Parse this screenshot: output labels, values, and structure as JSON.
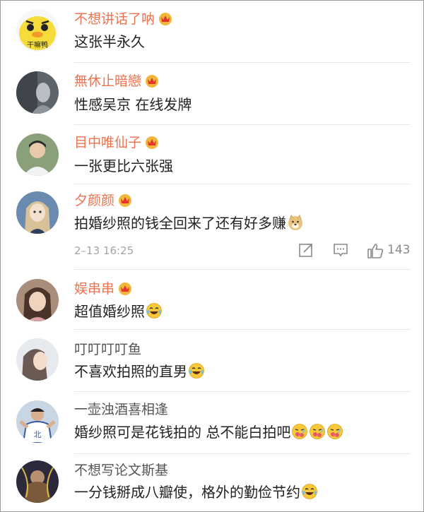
{
  "comments": [
    {
      "user": "不想讲话了呐",
      "vip": true,
      "avatar": "yellow-duck-avatar",
      "avatar_text": "干嘛鸭",
      "text": "这张半永久",
      "emoji": []
    },
    {
      "user": "無休止暗戀",
      "vip": true,
      "avatar": "gray-photo-avatar",
      "text": "性感吴京 在线发牌",
      "emoji": []
    },
    {
      "user": "目中唯仙子",
      "vip": true,
      "avatar": "man-portrait-avatar",
      "text": "一张更比六张强",
      "emoji": []
    },
    {
      "user": "夕颜颜",
      "vip": true,
      "avatar": "anime-girl-avatar",
      "text": "拍婚纱照的钱全回来了还有好多赚",
      "emoji": [
        "doge-emoji"
      ]
    },
    {
      "user": "娱串串",
      "vip": true,
      "avatar": "woman-portrait-avatar",
      "text": "超值婚纱照",
      "emoji": [
        "laugh-cry-emoji"
      ]
    },
    {
      "user": "叮叮叮叮鱼",
      "vip": false,
      "avatar": "pale-portrait-avatar",
      "text": "不喜欢拍照的直男",
      "emoji": [
        "laugh-cry-emoji"
      ]
    },
    {
      "user": "一壶浊酒喜相逢",
      "vip": false,
      "avatar": "athlete-avatar",
      "text": "婚纱照可是花钱拍的 总不能白拍吧",
      "emoji": [
        "drooling-emoji",
        "drooling-emoji",
        "drooling-emoji"
      ]
    },
    {
      "user": "不想写论文斯基",
      "vip": false,
      "avatar": "dark-fantasy-avatar",
      "text": "一分钱掰成八瓣使，格外的勤俭节约",
      "emoji": [
        "laugh-cry-emoji"
      ]
    }
  ],
  "thread_meta": {
    "timestamp": "2–13 16:25",
    "like_count": "143",
    "icons": [
      "share-icon",
      "comment-icon",
      "like-icon"
    ]
  },
  "colors": {
    "vip_name": "#eb7350",
    "normal_name": "#555555",
    "text": "#222222",
    "meta": "#a5a5a5"
  }
}
